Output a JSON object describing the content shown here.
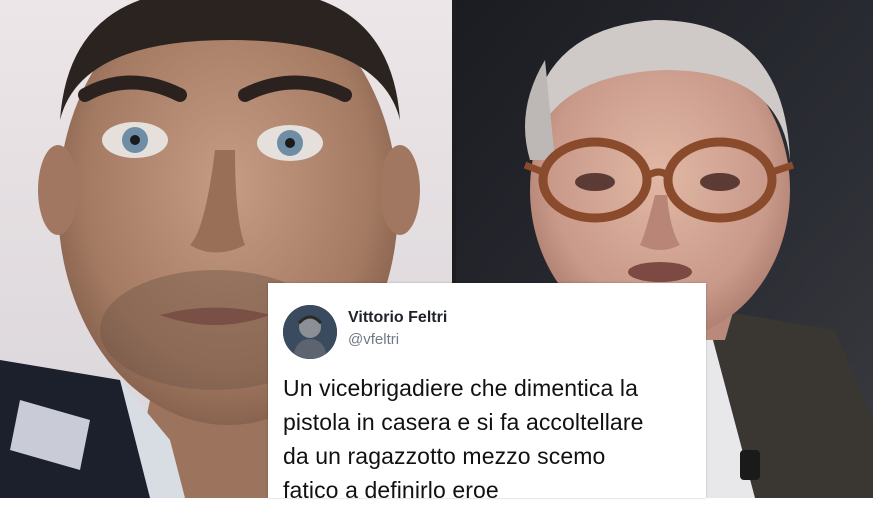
{
  "left_photo": {
    "subject": "portrait-in-uniform"
  },
  "right_photo": {
    "subject": "man-with-glasses"
  },
  "tweet": {
    "name": "Vittorio Feltri",
    "handle": "@vfeltri",
    "text": "Un vicebrigadiere che dimentica la\npistola in casera e si fa accoltellare\nda un ragazzotto  mezzo scemo\nfatico a definirlo eroe",
    "avatar": "user-avatar-icon"
  },
  "colors": {
    "card_background": "#ffffff",
    "name_text": "#1f2329",
    "handle_text": "#6e7a86",
    "tweet_text": "#111111"
  }
}
